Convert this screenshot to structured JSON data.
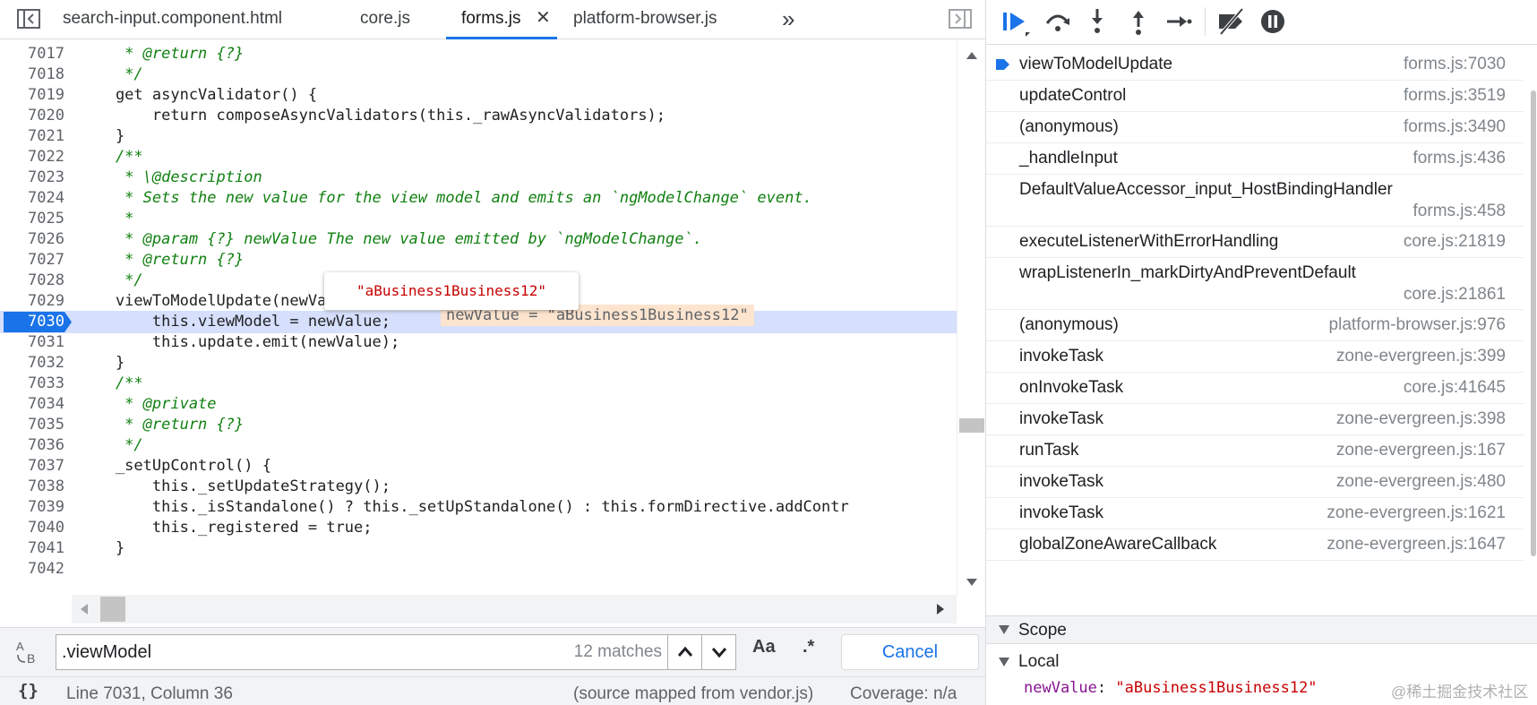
{
  "tabs": [
    {
      "label": "search-input.component.html"
    },
    {
      "label": "core.js"
    },
    {
      "label": "forms.js"
    },
    {
      "label": "platform-browser.js"
    }
  ],
  "tab_close_glyph": "✕",
  "tab_overflow_glyph": "»",
  "editor": {
    "lines": [
      {
        "n": "7017",
        "text": "     * @return {?}"
      },
      {
        "n": "7018",
        "text": "     */"
      },
      {
        "n": "7019",
        "text": "    get asyncValidator() {"
      },
      {
        "n": "7020",
        "text": "        return composeAsyncValidators(this._rawAsyncValidators);"
      },
      {
        "n": "7021",
        "text": "    }"
      },
      {
        "n": "7022",
        "text": "    /**"
      },
      {
        "n": "7023",
        "text": "     * \\@description"
      },
      {
        "n": "7024",
        "text": "     * Sets the new value for the view model and emits an `ngModelChange` event."
      },
      {
        "n": "7025",
        "text": "     *"
      },
      {
        "n": "7026",
        "text": "     * @param {?} newValue The new value emitted by `ngModelChange`."
      },
      {
        "n": "7027",
        "text": "     * @return {?}"
      },
      {
        "n": "7028",
        "text": "     */"
      },
      {
        "n": "7029",
        "text": "    viewToModelUpdate(newValue) {"
      },
      {
        "n": "7030",
        "text": "        this.viewModel = newValue;"
      },
      {
        "n": "7031",
        "text": "        this.update.emit(newValue);"
      },
      {
        "n": "7032",
        "text": "    }"
      },
      {
        "n": "7033",
        "text": "    /**"
      },
      {
        "n": "7034",
        "text": "     * @private"
      },
      {
        "n": "7035",
        "text": "     * @return {?}"
      },
      {
        "n": "7036",
        "text": "     */"
      },
      {
        "n": "7037",
        "text": "    _setUpControl() {"
      },
      {
        "n": "7038",
        "text": "        this._setUpdateStrategy();"
      },
      {
        "n": "7039",
        "text": "        this._isStandalone() ? this._setUpStandalone() : this.formDirective.addContr"
      },
      {
        "n": "7040",
        "text": "        this._registered = true;"
      },
      {
        "n": "7041",
        "text": "    }"
      },
      {
        "n": "7042",
        "text": ""
      }
    ],
    "current_line": "7030",
    "popover_value": "\"aBusiness1Business12\"",
    "inline_value": "newValue = \"aBusiness1Business12\""
  },
  "find": {
    "query": ".viewModel",
    "match_count": "12 matches",
    "case_label": "Aa",
    "regex_label": ".*",
    "cancel_label": "Cancel"
  },
  "status": {
    "braces": "{}",
    "position": "Line 7031, Column 36",
    "source": "(source mapped from vendor.js)",
    "coverage": "Coverage: n/a"
  },
  "callstack": [
    {
      "fn": "viewToModelUpdate",
      "loc": "forms.js:7030",
      "active": true
    },
    {
      "fn": "updateControl",
      "loc": "forms.js:3519"
    },
    {
      "fn": "(anonymous)",
      "loc": "forms.js:3490"
    },
    {
      "fn": "_handleInput",
      "loc": "forms.js:436"
    },
    {
      "fn": "DefaultValueAccessor_input_HostBindingHandler",
      "loc": "forms.js:458",
      "wrap": true
    },
    {
      "fn": "executeListenerWithErrorHandling",
      "loc": "core.js:21819"
    },
    {
      "fn": "wrapListenerIn_markDirtyAndPreventDefault",
      "loc": "core.js:21861",
      "wrap": true
    },
    {
      "fn": "(anonymous)",
      "loc": "platform-browser.js:976"
    },
    {
      "fn": "invokeTask",
      "loc": "zone-evergreen.js:399"
    },
    {
      "fn": "onInvokeTask",
      "loc": "core.js:41645"
    },
    {
      "fn": "invokeTask",
      "loc": "zone-evergreen.js:398"
    },
    {
      "fn": "runTask",
      "loc": "zone-evergreen.js:167"
    },
    {
      "fn": "invokeTask",
      "loc": "zone-evergreen.js:480"
    },
    {
      "fn": "invokeTask",
      "loc": "zone-evergreen.js:1621"
    },
    {
      "fn": "globalZoneAwareCallback",
      "loc": "zone-evergreen.js:1647"
    }
  ],
  "scope": {
    "title": "Scope",
    "local_title": "Local",
    "var_name": "newValue",
    "var_value": "\"aBusiness1Business12\""
  },
  "watermark": "@稀土掘金技术社区",
  "colors": {
    "accent": "#1a73e8",
    "current_line_bg": "#d6dffb",
    "comment": "#118011",
    "keyword": "#aa0d91",
    "string_value": "#c80000"
  }
}
